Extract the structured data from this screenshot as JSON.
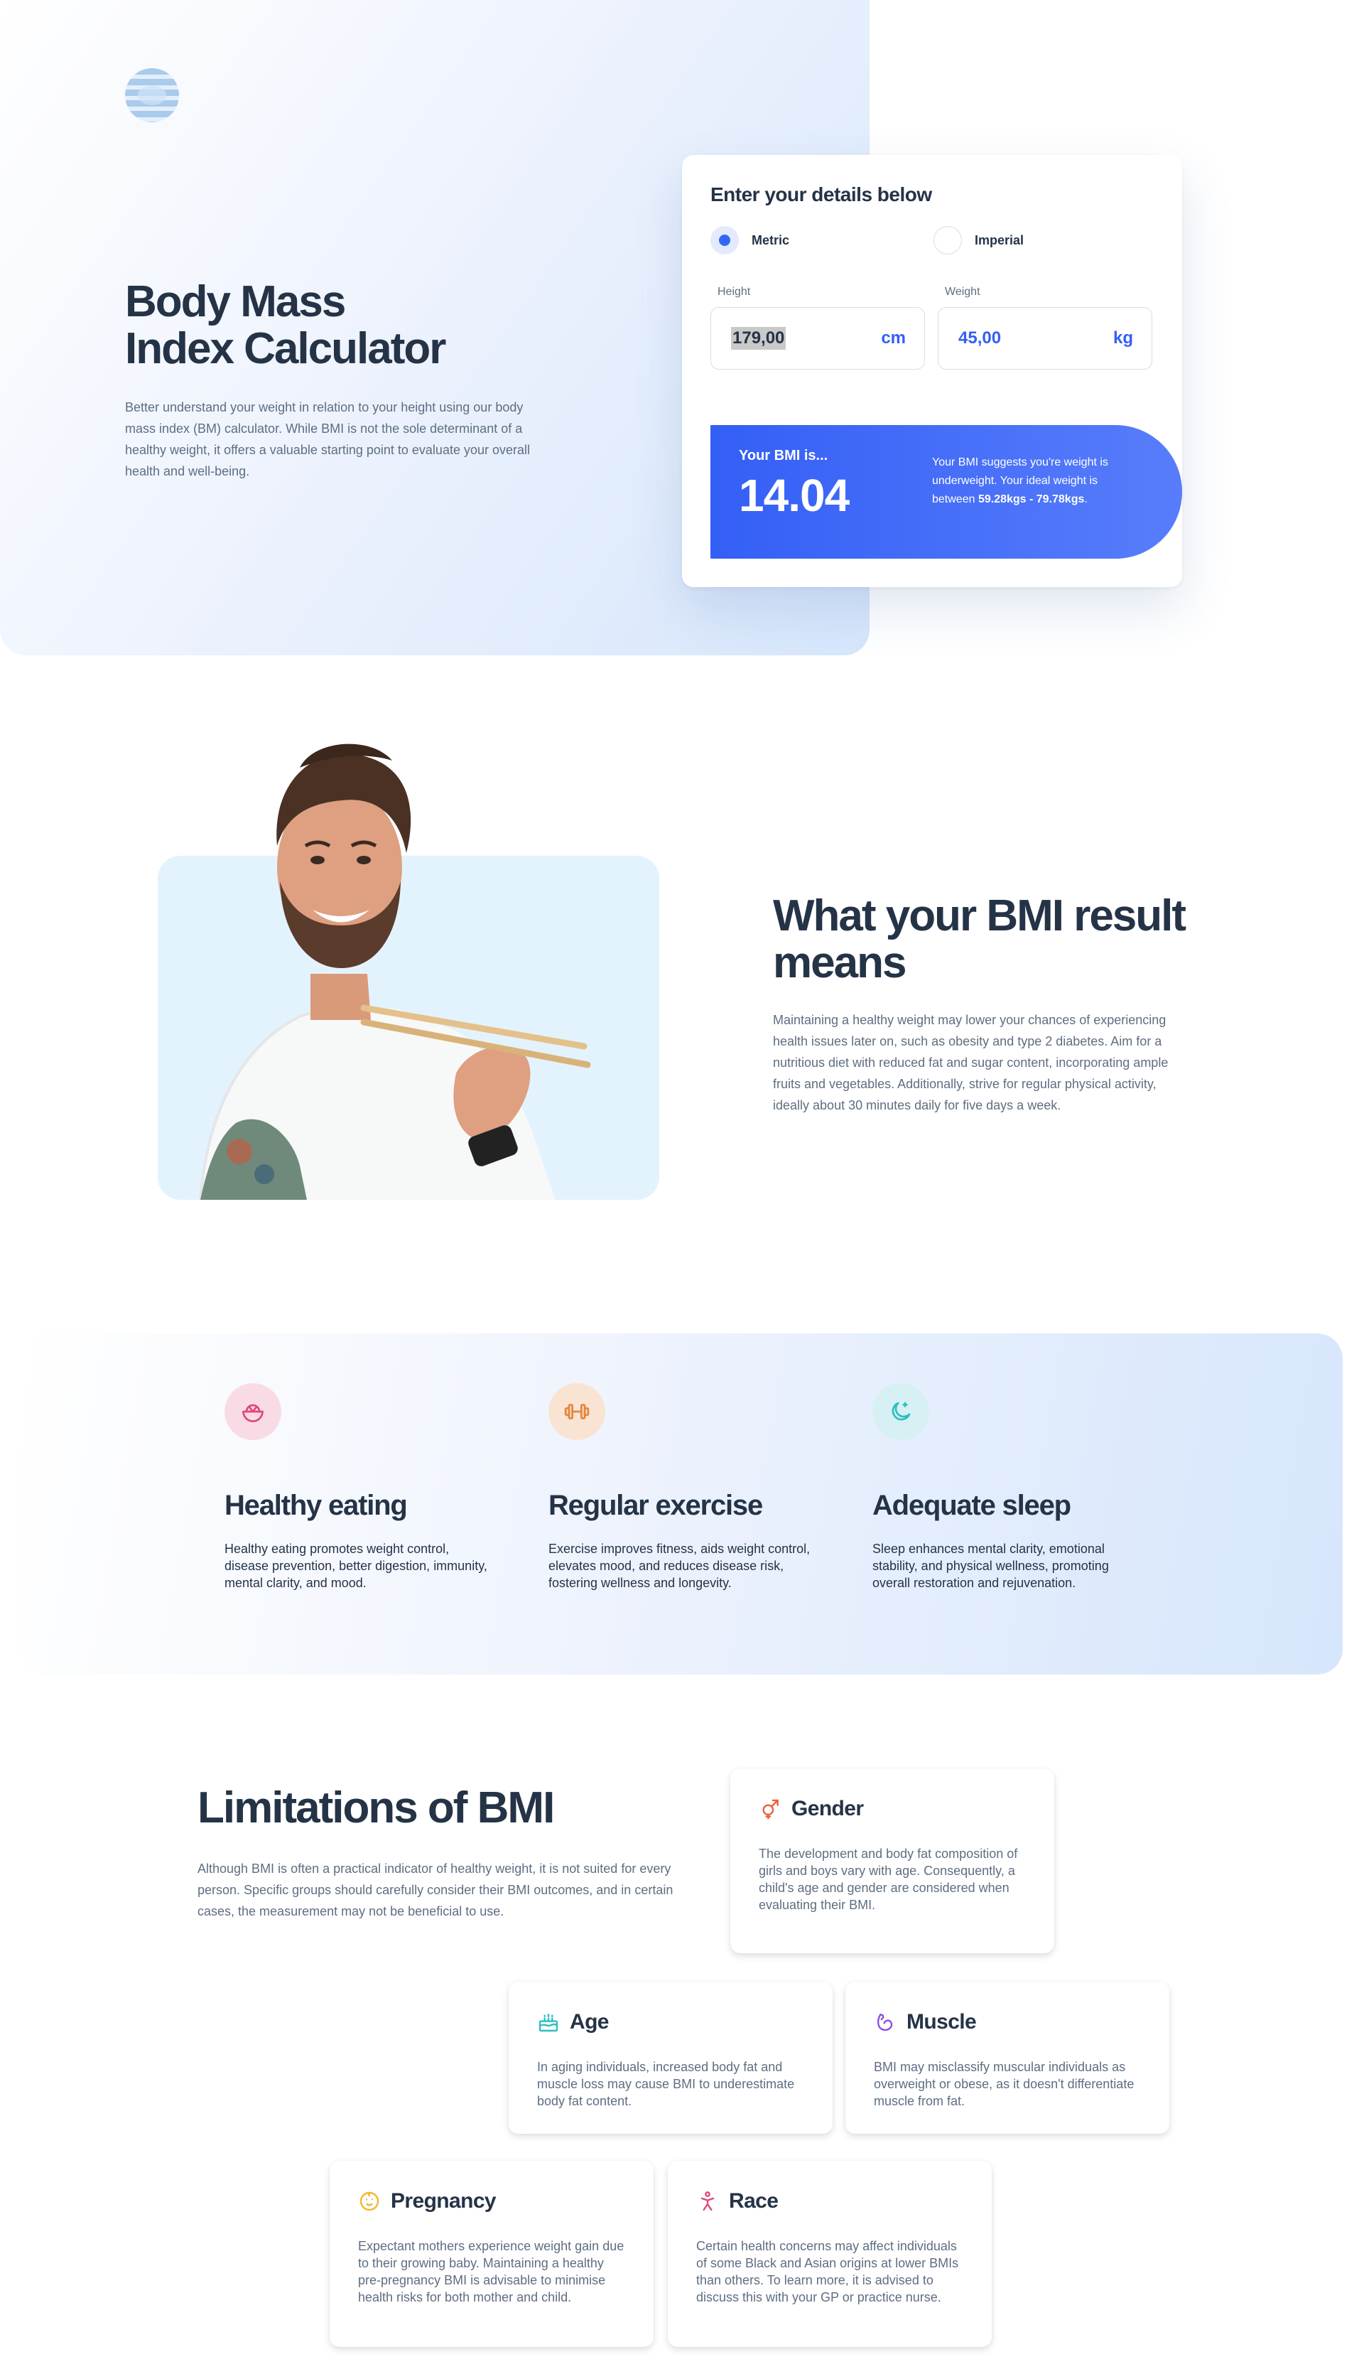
{
  "hero": {
    "title_line1": "Body Mass",
    "title_line2": "Index Calculator",
    "description": "Better understand your weight in relation to your height using our body mass index (BM) calculator. While BMI is not the sole determinant of a healthy weight, it offers a valuable starting point to evaluate your overall health and well-being."
  },
  "calculator": {
    "title": "Enter your details below",
    "unit_options": [
      {
        "label": "Metric",
        "selected": true
      },
      {
        "label": "Imperial",
        "selected": false
      }
    ],
    "height": {
      "label": "Height",
      "value": "179,00",
      "unit": "cm"
    },
    "weight": {
      "label": "Weight",
      "value": "45,00",
      "unit": "kg"
    },
    "result": {
      "label": "Your BMI is...",
      "value": "14.04",
      "message_prefix": "Your BMI suggests you're weight is underweight. Your ideal weight is between ",
      "range": "59.28kgs - 79.78kgs",
      "message_suffix": "."
    }
  },
  "meaning": {
    "title": "What your BMI result means",
    "description": "Maintaining a healthy weight may lower your chances of experiencing health issues later on, such as obesity and type 2 diabetes. Aim for a nutritious diet with reduced fat and sugar content, incorporating ample fruits and vegetables. Additionally, strive for regular physical activity, ideally about 30 minutes daily for five days a week."
  },
  "tips": [
    {
      "icon": "bowl-icon",
      "title": "Healthy eating",
      "text": "Healthy eating promotes weight control, disease prevention, better digestion, immunity, mental clarity, and mood.",
      "color": "#e1467c",
      "bg": "#f9dbe6"
    },
    {
      "icon": "dumbbell-icon",
      "title": "Regular exercise",
      "text": "Exercise improves fitness, aids weight control, elevates mood, and reduces disease risk, fostering wellness and longevity.",
      "color": "#e4873f",
      "bg": "#f9e4d4"
    },
    {
      "icon": "moon-stars-icon",
      "title": "Adequate sleep",
      "text": "Sleep enhances mental clarity, emotional stability, and physical wellness, promoting overall restoration and rejuvenation.",
      "color": "#2cbfbf",
      "bg": "#d7f0f3"
    }
  ],
  "limitations": {
    "title": "Limitations of BMI",
    "description": "Although BMI is often a practical indicator of healthy weight, it is not suited for every person. Specific groups should carefully consider their BMI outcomes, and in certain cases, the measurement may not be beneficial to use.",
    "cards": [
      {
        "key": "gender",
        "icon": "gender-icon",
        "title": "Gender",
        "text": "The development and body fat composition of girls and boys vary with age. Consequently, a child's age and gender are considered when evaluating their BMI.",
        "color": "#e8603c"
      },
      {
        "key": "age",
        "icon": "birthday-cake-icon",
        "title": "Age",
        "text": "In aging individuals, increased body fat and muscle loss may cause BMI to underestimate body fat content.",
        "color": "#2cbfbf"
      },
      {
        "key": "muscle",
        "icon": "bicep-icon",
        "title": "Muscle",
        "text": "BMI may misclassify muscular individuals as overweight or obese, as it doesn't differentiate muscle from fat.",
        "color": "#8b4de6"
      },
      {
        "key": "pregnancy",
        "icon": "baby-face-icon",
        "title": "Pregnancy",
        "text": "Expectant mothers experience weight gain due to their growing baby. Maintaining a healthy pre-pregnancy BMI is advisable to minimise health risks for both mother and child.",
        "color": "#f2b72c"
      },
      {
        "key": "race",
        "icon": "person-pose-icon",
        "title": "Race",
        "text": "Certain health concerns may affect individuals of some Black and Asian origins at lower BMIs than others. To learn more, it is advised to discuss this with your GP or practice nurse.",
        "color": "#e1467c"
      }
    ]
  }
}
